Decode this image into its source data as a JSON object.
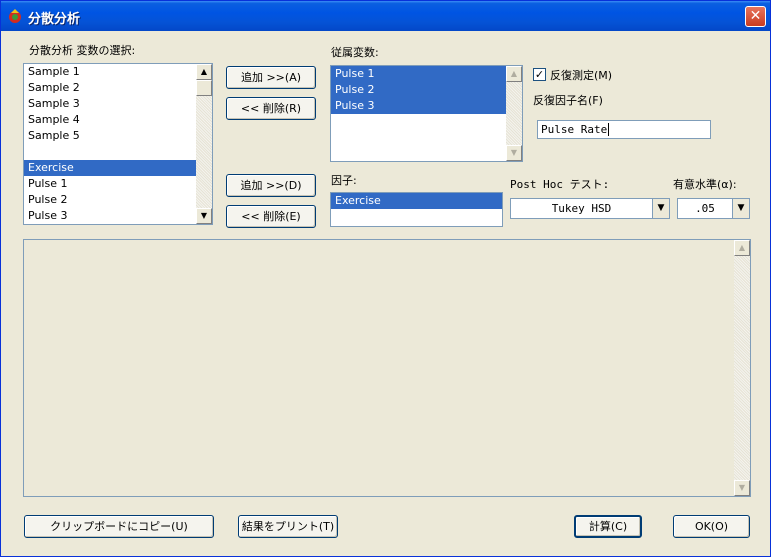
{
  "window": {
    "title": "分散分析",
    "close_label": "✕"
  },
  "variables": {
    "label": "分散分析 変数の選択:",
    "items": [
      "Sample 1",
      "Sample 2",
      "Sample 3",
      "Sample 4",
      "Sample 5",
      "",
      "Exercise",
      "Pulse 1",
      "Pulse 2",
      "Pulse 3"
    ],
    "selected_index": 6
  },
  "buttons": {
    "add_dependent": "追加 >>(A)",
    "remove_dependent": "<< 削除(R)",
    "add_factor": "追加 >>(D)",
    "remove_factor": "<< 削除(E)",
    "copy_clipboard": "クリップボードにコピー(U)",
    "print_results": "結果をプリント(T)",
    "calculate": "計算(C)",
    "ok": "OK(O)"
  },
  "dependent": {
    "label": "従属変数:",
    "items": [
      "Pulse 1",
      "Pulse 2",
      "Pulse 3"
    ]
  },
  "repeated_measures": {
    "label": "反復測定(M)",
    "checked": true
  },
  "repeated_factor": {
    "label": "反復因子名(F)",
    "value": "Pulse Rate"
  },
  "factor": {
    "label": "因子:",
    "items": [
      "Exercise"
    ]
  },
  "posthoc": {
    "label": "Post Hoc テスト:",
    "value": "Tukey HSD"
  },
  "alpha": {
    "label": "有意水準(α):",
    "value": ".05"
  },
  "icons": {
    "up": "▲",
    "down": "▼",
    "check": "✓"
  },
  "colors": {
    "title_blue": "#0054e3",
    "selection": "#316ac5",
    "close_red": "#c93c20"
  }
}
